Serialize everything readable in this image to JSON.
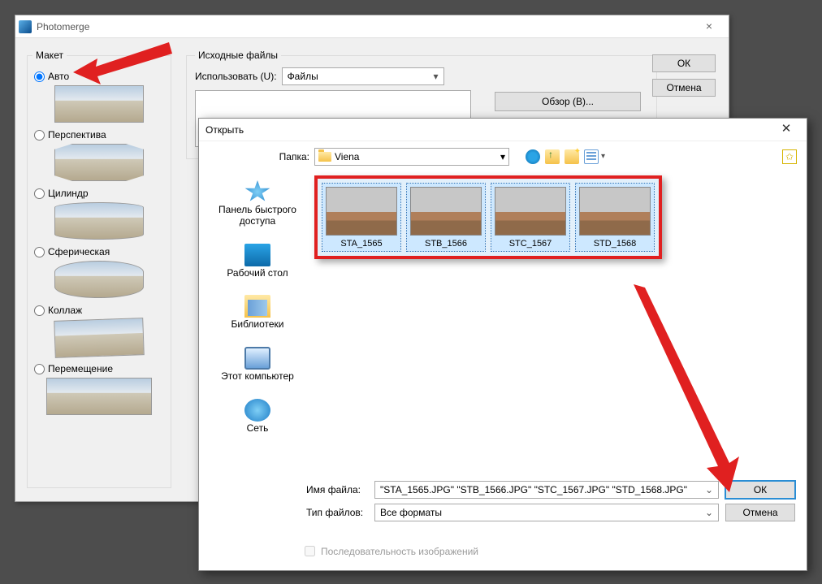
{
  "photomerge": {
    "title": "Photomerge",
    "ok": "ОК",
    "cancel": "Отмена",
    "layout_legend": "Макет",
    "layouts": {
      "auto": "Авто",
      "perspective": "Перспектива",
      "cylinder": "Цилиндр",
      "spherical": "Сферическая",
      "collage": "Коллаж",
      "reposition": "Перемещение"
    },
    "source_legend": "Исходные файлы",
    "use_label": "Использовать (U):",
    "use_value": "Файлы",
    "browse": "Обзор (B)..."
  },
  "open": {
    "title": "Открыть",
    "folder_label": "Папка:",
    "folder_value": "Viena",
    "star_button": "✩",
    "places": {
      "quick": "Панель быстрого доступа",
      "desktop": "Рабочий стол",
      "libraries": "Библиотеки",
      "thispc": "Этот компьютер",
      "network": "Сеть"
    },
    "thumbs": [
      "STA_1565",
      "STB_1566",
      "STC_1567",
      "STD_1568"
    ],
    "filename_label": "Имя файла:",
    "filename_value": "\"STA_1565.JPG\" \"STB_1566.JPG\" \"STC_1567.JPG\" \"STD_1568.JPG\"",
    "filetype_label": "Тип файлов:",
    "filetype_value": "Все форматы",
    "ok": "ОК",
    "cancel": "Отмена",
    "sequence": "Последовательность изображений"
  }
}
